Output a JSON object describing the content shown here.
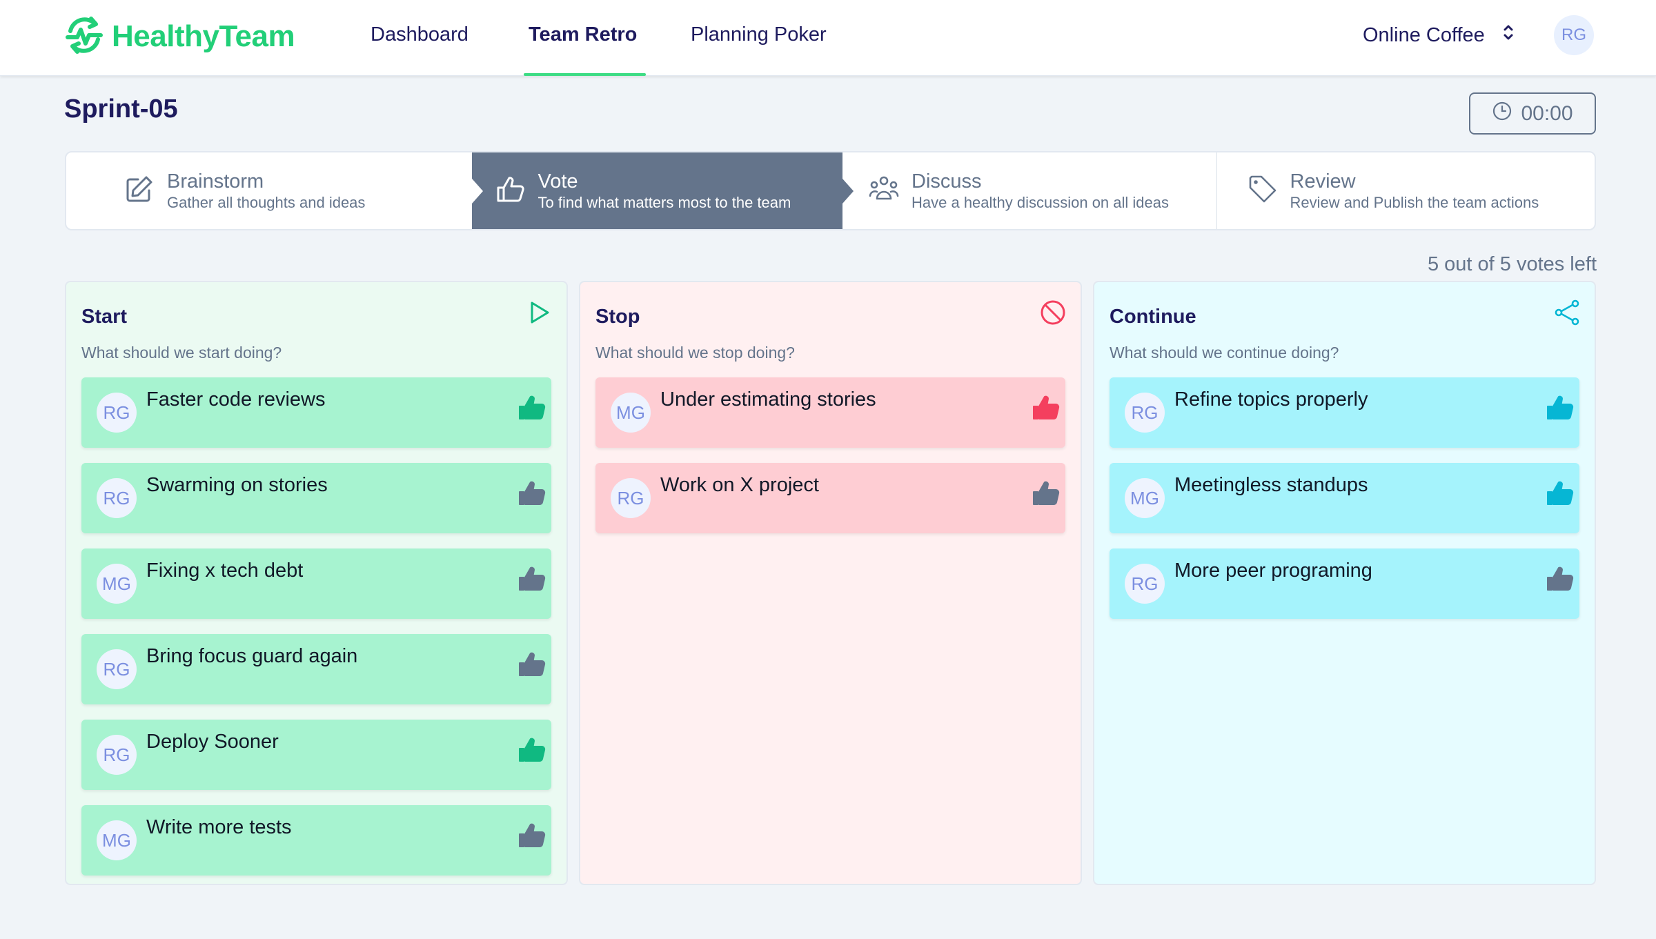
{
  "app": {
    "brand": "HealthyTeam",
    "brand_color": "#22cf78",
    "logo_icon": "heartbeat-refresh-icon"
  },
  "nav": {
    "items": [
      {
        "label": "Dashboard",
        "active": false
      },
      {
        "label": "Team Retro",
        "active": true
      },
      {
        "label": "Planning Poker",
        "active": false
      }
    ]
  },
  "team_selector": {
    "value": "Online Coffee",
    "icon": "chevron-up-down-icon"
  },
  "user": {
    "initials": "RG"
  },
  "page": {
    "title": "Sprint-05",
    "timer": {
      "value": "00:00",
      "icon": "clock-icon"
    }
  },
  "steps": [
    {
      "title": "Brainstorm",
      "subtitle": "Gather all thoughts and ideas",
      "icon": "pencil-square-icon",
      "active": false
    },
    {
      "title": "Vote",
      "subtitle": "To find what matters most to the team",
      "icon": "thumbs-up-icon",
      "active": true
    },
    {
      "title": "Discuss",
      "subtitle": "Have a healthy discussion on all ideas",
      "icon": "user-group-icon",
      "active": false
    },
    {
      "title": "Review",
      "subtitle": "Review and Publish the team actions",
      "icon": "tag-icon",
      "active": false
    }
  ],
  "votes": {
    "text": "5 out of 5 votes left",
    "remaining": 5,
    "total": 5
  },
  "colors": {
    "active_step": "#64748b",
    "start_accent": "#10b981",
    "stop_accent": "#f43f5e",
    "continue_accent": "#06b6d4",
    "thumb_neutral": "#64748b"
  },
  "columns": [
    {
      "title": "Start",
      "subtitle": "What should we start doing?",
      "icon": "play-icon",
      "cards": [
        {
          "initials": "RG",
          "text": "Faster code reviews",
          "highlighted": true
        },
        {
          "initials": "RG",
          "text": "Swarming on stories",
          "highlighted": false
        },
        {
          "initials": "MG",
          "text": "Fixing x tech debt",
          "highlighted": false
        },
        {
          "initials": "RG",
          "text": "Bring focus guard again",
          "highlighted": false
        },
        {
          "initials": "RG",
          "text": "Deploy Sooner",
          "highlighted": true
        },
        {
          "initials": "MG",
          "text": "Write more tests",
          "highlighted": false
        }
      ]
    },
    {
      "title": "Stop",
      "subtitle": "What should we stop doing?",
      "icon": "ban-icon",
      "cards": [
        {
          "initials": "MG",
          "text": "Under estimating stories",
          "highlighted": true
        },
        {
          "initials": "RG",
          "text": "Work on X project",
          "highlighted": false
        }
      ]
    },
    {
      "title": "Continue",
      "subtitle": "What should we continue doing?",
      "icon": "share-icon",
      "cards": [
        {
          "initials": "RG",
          "text": "Refine topics properly",
          "highlighted": true
        },
        {
          "initials": "MG",
          "text": "Meetingless standups",
          "highlighted": true
        },
        {
          "initials": "RG",
          "text": "More peer programing",
          "highlighted": false
        }
      ]
    }
  ]
}
